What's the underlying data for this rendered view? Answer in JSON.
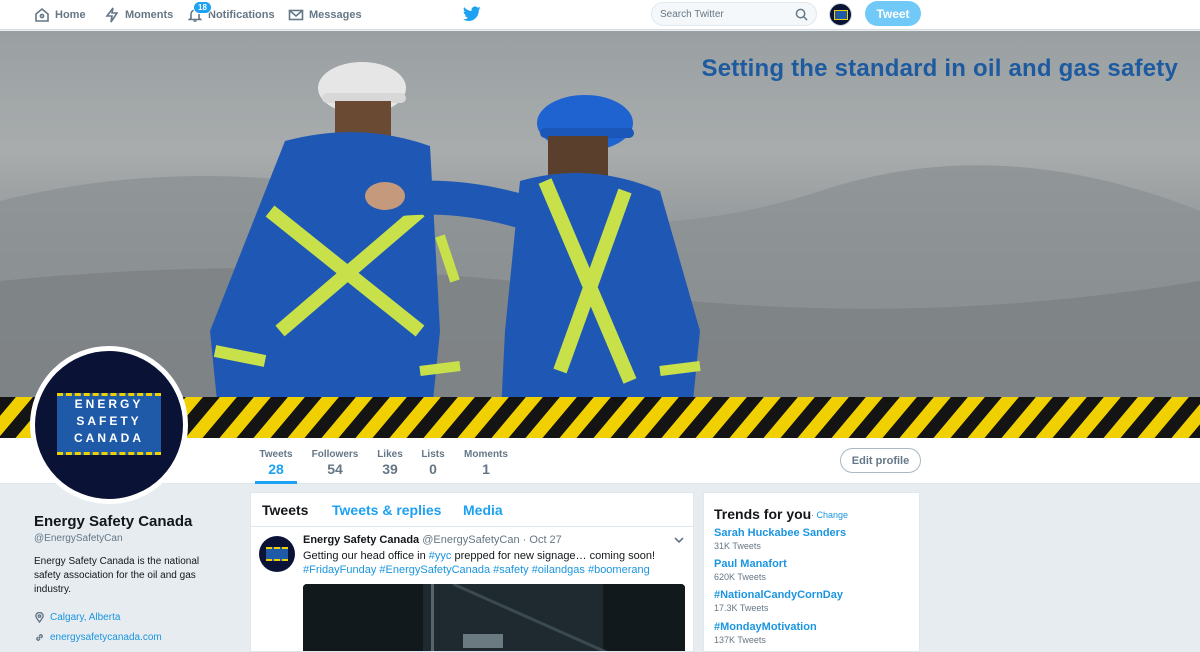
{
  "nav": {
    "items": [
      {
        "label": "Home",
        "icon": "home-icon"
      },
      {
        "label": "Moments",
        "icon": "lightning-icon"
      },
      {
        "label": "Notifications",
        "icon": "bell-icon",
        "badge": "18"
      },
      {
        "label": "Messages",
        "icon": "envelope-icon"
      }
    ],
    "search_placeholder": "Search Twitter",
    "tweet_button": "Tweet"
  },
  "banner": {
    "headline": "Setting the standard in oil and gas safety"
  },
  "profile": {
    "logo_lines": [
      "ENERGY",
      "SAFETY",
      "CANADA"
    ],
    "name": "Energy Safety Canada",
    "handle": "@EnergySafetyCan",
    "bio": "Energy Safety Canada is the national safety association for the oil and gas industry.",
    "location": "Calgary, Alberta",
    "website": "energysafetycanada.com",
    "edit_profile": "Edit profile"
  },
  "stats": [
    {
      "label": "Tweets",
      "value": "28"
    },
    {
      "label": "Followers",
      "value": "54"
    },
    {
      "label": "Likes",
      "value": "39"
    },
    {
      "label": "Lists",
      "value": "0"
    },
    {
      "label": "Moments",
      "value": "1"
    }
  ],
  "timeline": {
    "tabs": [
      "Tweets",
      "Tweets & replies",
      "Media"
    ],
    "tweet": {
      "name": "Energy Safety Canada",
      "handle": "@EnergySafetyCan",
      "date": "· Oct 27",
      "text_before": "Getting our head office in ",
      "mention": "#yyc",
      "text_after": " prepped for new signage… coming soon!",
      "hashtags": "#FridayFunday #EnergySafetyCanada #safety #oilandgas #boomerang"
    }
  },
  "trends": {
    "title": "Trends for you",
    "change": "· Change",
    "items": [
      {
        "name": "Sarah Huckabee Sanders",
        "count": "31K Tweets"
      },
      {
        "name": "Paul Manafort",
        "count": "620K Tweets"
      },
      {
        "name": "#NationalCandyCornDay",
        "count": "17.3K Tweets"
      },
      {
        "name": "#MondayMotivation",
        "count": "137K Tweets"
      }
    ]
  },
  "colors": {
    "accent": "#1da1f2",
    "brand_navy": "#0a1236",
    "brand_blue": "#1e5aa8",
    "hazard_yellow": "#f0d000"
  }
}
